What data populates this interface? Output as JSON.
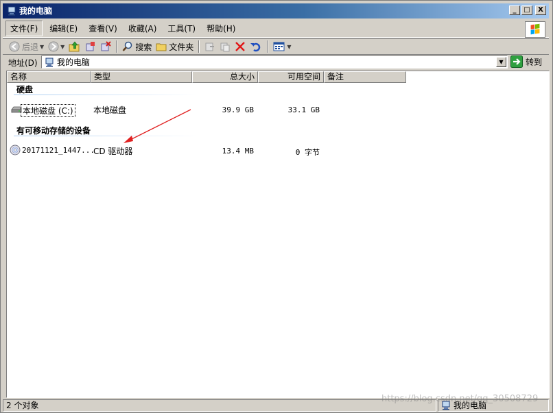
{
  "window": {
    "title": "我的电脑",
    "minimize": "_",
    "maximize": "□",
    "close": "X"
  },
  "menu": [
    {
      "label": "文件(F)"
    },
    {
      "label": "编辑(E)"
    },
    {
      "label": "查看(V)"
    },
    {
      "label": "收藏(A)"
    },
    {
      "label": "工具(T)"
    },
    {
      "label": "帮助(H)"
    }
  ],
  "toolbar": {
    "back_label": "后退",
    "search_label": "搜索",
    "folders_label": "文件夹"
  },
  "address": {
    "label": "地址(D)",
    "value": "我的电脑",
    "go_label": "转到"
  },
  "columns": [
    {
      "label": "名称"
    },
    {
      "label": "类型"
    },
    {
      "label": "总大小"
    },
    {
      "label": "可用空间"
    },
    {
      "label": "备注"
    }
  ],
  "groups": [
    {
      "title": "硬盘",
      "items": [
        {
          "name": "本地磁盘 (C:)",
          "type": "本地磁盘",
          "total": "39.9 GB",
          "free": "33.1 GB",
          "icon": "hard-drive-icon"
        }
      ]
    },
    {
      "title": "有可移动存储的设备",
      "items": [
        {
          "name": "20171121_1447...",
          "type": "CD 驱动器",
          "total": "13.4 MB",
          "free": "0 字节",
          "icon": "cd-drive-icon"
        }
      ]
    }
  ],
  "status": {
    "count": "2 个对象",
    "location": "我的电脑"
  },
  "watermark": "https://blog.csdn.net/qq_30508729",
  "colors": {
    "titlebar_start": "#0a246a",
    "titlebar_end": "#a6caf0",
    "face": "#d4d0c8",
    "annotation_arrow": "#e02020"
  }
}
